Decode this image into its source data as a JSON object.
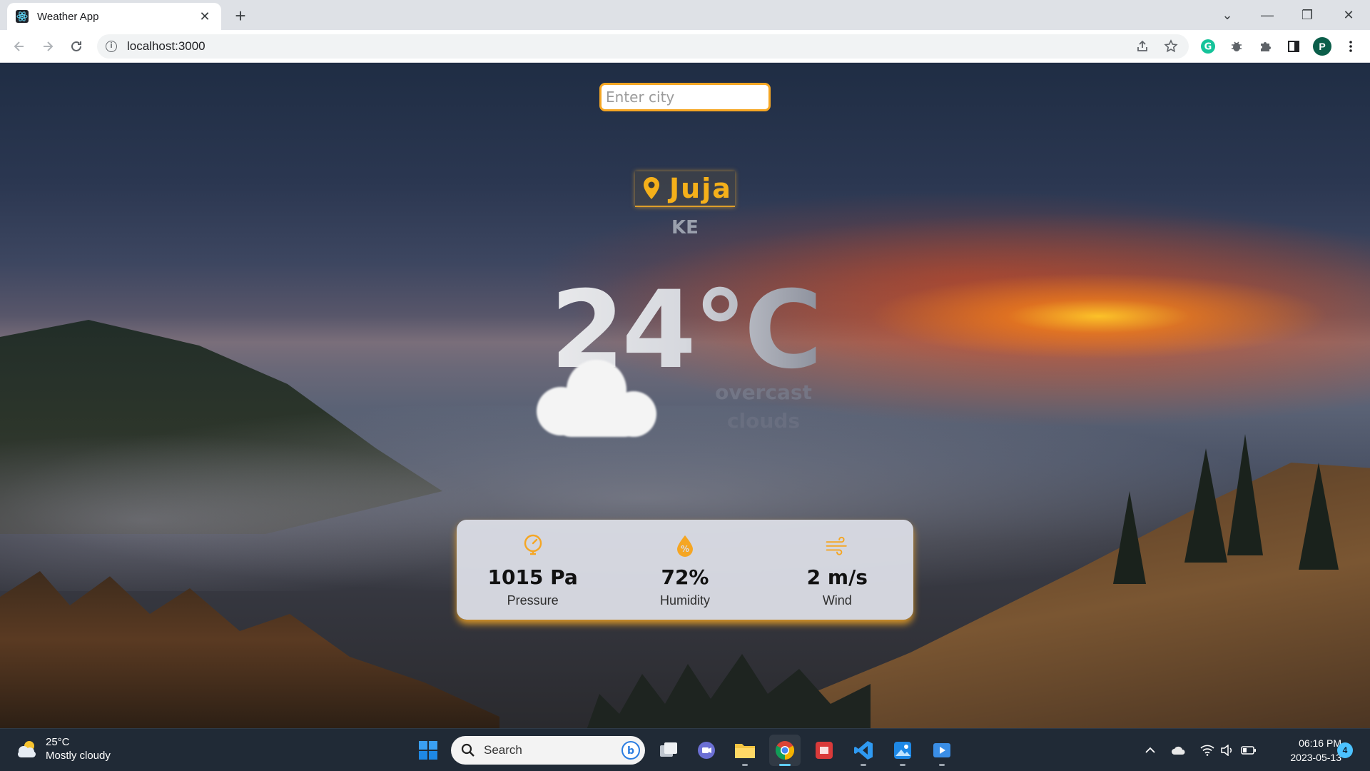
{
  "browser": {
    "tab_title": "Weather App",
    "tab_close": "✕",
    "new_tab": "+",
    "url": "localhost:3000",
    "profile_initial": "P",
    "window_controls": [
      "⌄",
      "—",
      "❐",
      "✕"
    ]
  },
  "app": {
    "search": {
      "placeholder": "Enter city",
      "value": ""
    },
    "city": "Juja",
    "country": "KE",
    "temperature": "24°C",
    "description_line1": "overcast",
    "description_line2": "clouds",
    "weather_icon": "cloud-icon",
    "accent_color": "#f5a623",
    "stats": [
      {
        "icon": "gauge-icon",
        "value": "1015 Pa",
        "label": "Pressure"
      },
      {
        "icon": "humidity-drop-icon",
        "value": "72%",
        "label": "Humidity"
      },
      {
        "icon": "wind-icon",
        "value": "2 m/s",
        "label": "Wind"
      }
    ]
  },
  "taskbar": {
    "weather_temp": "25°C",
    "weather_desc": "Mostly cloudy",
    "search_label": "Search",
    "time": "06:16 PM",
    "date": "2023-05-13",
    "notifications": "4"
  }
}
